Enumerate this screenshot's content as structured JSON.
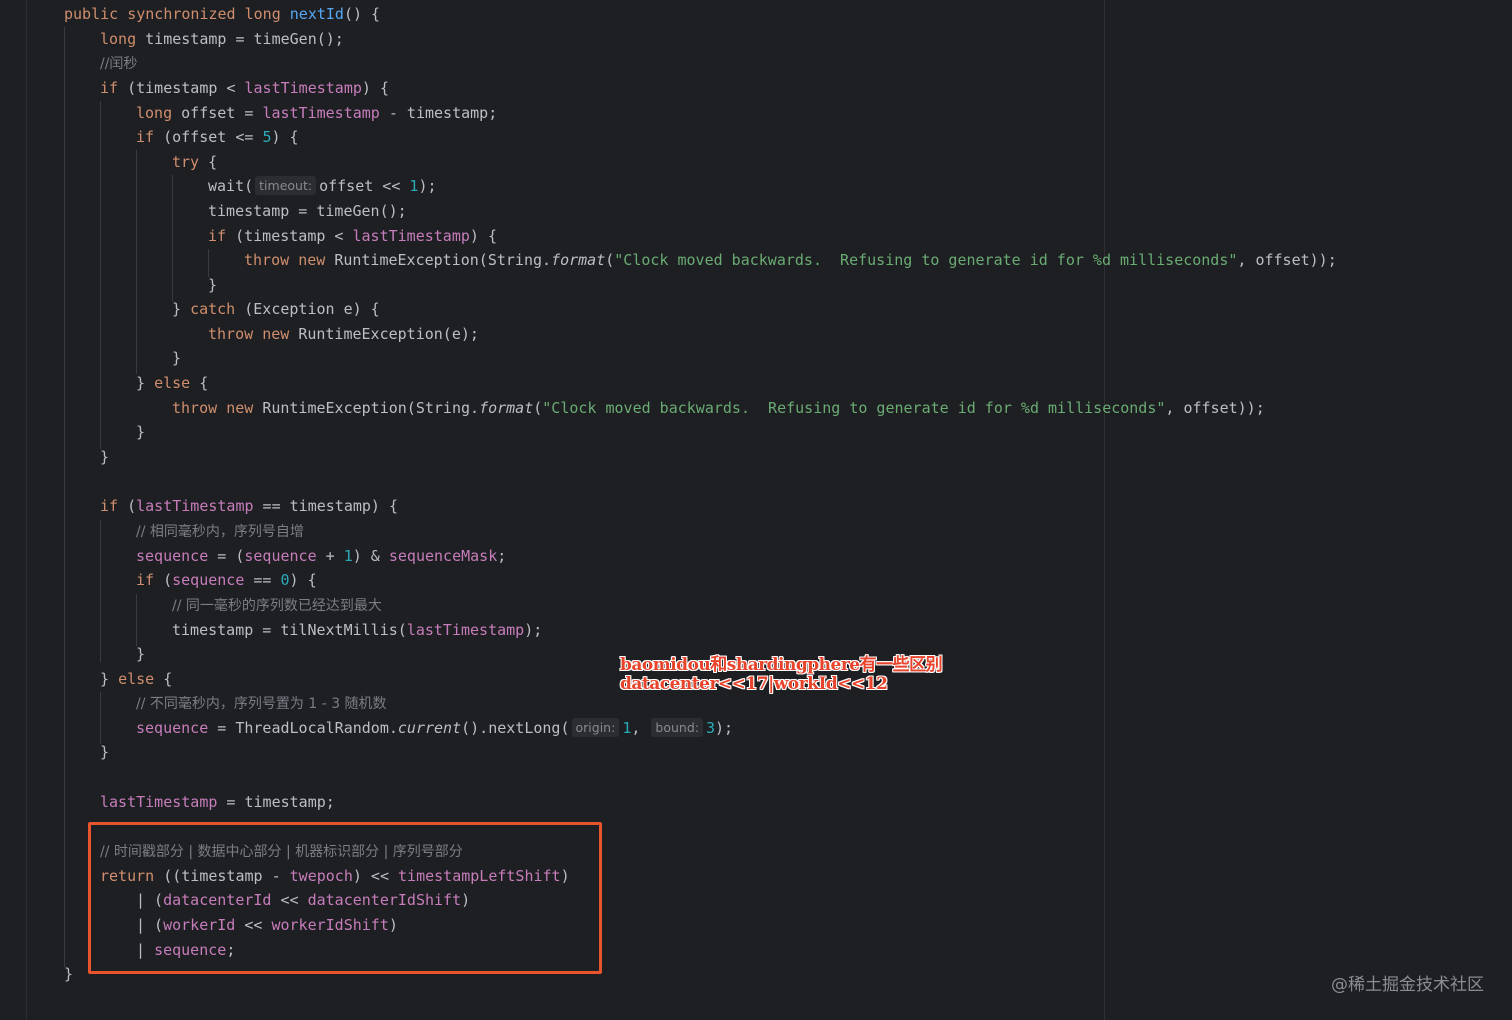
{
  "code": {
    "method_signature": {
      "modifiers": "public synchronized long ",
      "name": "nextId",
      "rest": "() {"
    },
    "l_ts_decl": "timestamp = timeGen();",
    "l_leap_comment": "//闰秒",
    "l_if_ts_lt_a": "(timestamp < ",
    "l_if_ts_lt_b": ") {",
    "l_offset_a": "offset = ",
    "l_offset_b": " - timestamp;",
    "l_if_offset_a": "(offset <= ",
    "l_if_offset_num": "5",
    "l_if_offset_b": ") {",
    "l_try": " {",
    "l_wait_a": "wait(",
    "l_wait_hint": "timeout:",
    "l_wait_b": "offset << ",
    "l_wait_num": "1",
    "l_wait_c": ");",
    "l_ts_regen": "timestamp = timeGen();",
    "l_if_inner_a": "(timestamp < ",
    "l_if_inner_b": ") {",
    "l_throw1_a": "RuntimeException(String.",
    "l_format": "format",
    "l_throw_str": "\"Clock moved backwards.  Refusing to generate id for %d milliseconds\"",
    "l_throw1_b": ", offset));",
    "l_close": "}",
    "l_catch_a": "} ",
    "l_catch_b": " (Exception e) {",
    "l_throw2": "RuntimeException(e);",
    "l_else_a": "} ",
    "l_else_b": " {",
    "l_if_last_a": "(",
    "l_if_last_b": " == timestamp) {",
    "l_cmt_same_ms": "// 相同毫秒内，序列号自增",
    "l_seq_a": " = (",
    "l_seq_num": "1",
    "l_seq_b": ") & ",
    "l_seq_mask": "sequenceMask",
    "l_if_seq_a": "(",
    "l_if_seq_b": " == ",
    "l_if_seq_num": "0",
    "l_if_seq_c": ") {",
    "l_cmt_max": "// 同一毫秒的序列数已经达到最大",
    "l_til_a": "timestamp = tilNextMillis(",
    "l_til_b": ");",
    "l_cmt_diff": "// 不同毫秒内，序列号置为 1 - 3 随机数",
    "l_rand_a": " = ThreadLocalRandom.",
    "l_rand_current": "current",
    "l_rand_b": "().nextLong(",
    "l_rand_hint1": "origin:",
    "l_rand_num1": "1",
    "l_rand_comma": ", ",
    "l_rand_hint2": "bound:",
    "l_rand_num2": "3",
    "l_rand_c": ");",
    "l_assign_last": " = timestamp;",
    "l_cmt_parts": "// 时间戳部分 | 数据中心部分 | 机器标识部分 | 序列号部分",
    "l_ret_a": " ((timestamp - ",
    "l_ret_b": ") << ",
    "l_ret_c": ")",
    "l_dc_a": "| (",
    "l_dc_b": " << ",
    "l_dc_c": ")",
    "l_wk_a": "| (",
    "l_wk_b": " << ",
    "l_wk_c": ")",
    "l_seq_end_a": "| ",
    "l_seq_end_b": ";",
    "l_final_close": "}"
  },
  "keywords": {
    "long": "long",
    "if": "if",
    "try": "try",
    "throw": "throw",
    "new": "new",
    "catch": "catch",
    "else": "else",
    "return": "return"
  },
  "fields": {
    "lastTimestamp": "lastTimestamp",
    "sequence": "sequence",
    "twepoch": "twepoch",
    "timestampLeftShift": "timestampLeftShift",
    "datacenterId": "datacenterId",
    "datacenterIdShift": "datacenterIdShift",
    "workerId": "workerId",
    "workerIdShift": "workerIdShift"
  },
  "annotation": {
    "line1": "baomidou和shardingphere有一些区别",
    "line2": "datacenter<<17|workId<<12"
  },
  "watermark": "@稀土掘金技术社区",
  "colors": {
    "background": "#1e1f22",
    "keyword": "#cf8e6d",
    "field": "#c77dbb",
    "string": "#6aab73",
    "number": "#2aacb8",
    "comment": "#7a7e85",
    "highlight_box": "#e8542c",
    "annotation": "#e8442c"
  }
}
